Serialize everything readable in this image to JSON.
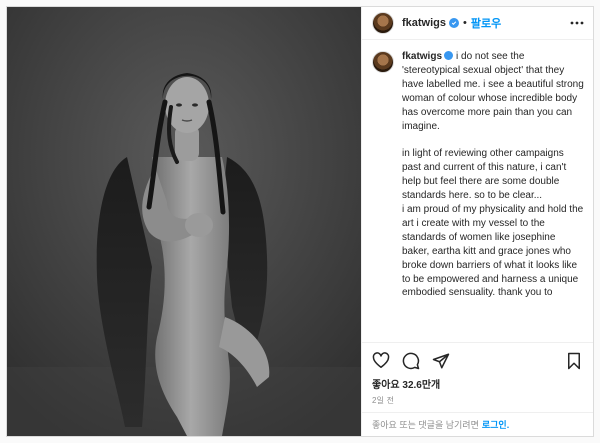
{
  "header": {
    "username": "fkatwigs",
    "follow_label": "팔로우"
  },
  "caption": {
    "username": "fkatwigs",
    "text": "i do not see the 'stereotypical sexual object' that they have labelled me. i see a beautiful strong woman of colour whose incredible body has overcome more pain than you can imagine.\n\nin light of reviewing other campaigns past and current of this nature, i can't help but feel there are some double standards here. so to be clear...\ni am proud of my physicality and hold the art i create with my vessel to the standards of women like josephine baker, eartha kitt and grace jones who broke down barriers of what it looks like to be empowered and harness a unique embodied sensuality. thank you to"
  },
  "actions": {
    "like_icon": "heart-icon",
    "comment_icon": "comment-icon",
    "share_icon": "share-icon",
    "save_icon": "bookmark-icon"
  },
  "likes": {
    "text": "좋아요 32.6만개"
  },
  "posted": {
    "text": "2일 전"
  },
  "comment_bar": {
    "prompt": "좋아요 또는 댓글을 남기려면",
    "login_label": "로그인."
  },
  "colors": {
    "accent": "#0095f6",
    "verified": "#3897f0",
    "text": "#262626",
    "muted": "#8e8e8e"
  }
}
